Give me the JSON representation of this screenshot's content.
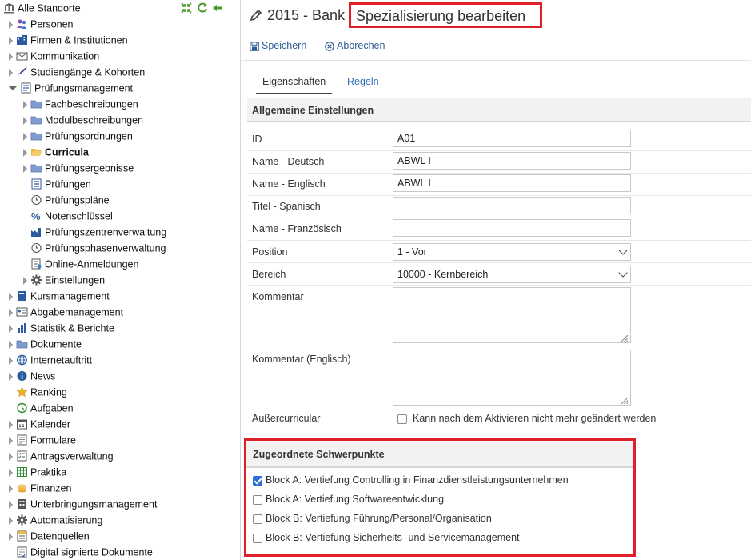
{
  "sidebar": {
    "root_label": "Alle Standorte",
    "items": [
      {
        "label": "Personen",
        "level": 1,
        "exp": "closed",
        "icon": "persons-icon",
        "bold": false
      },
      {
        "label": "Firmen & Institutionen",
        "level": 1,
        "exp": "closed",
        "icon": "companies-icon",
        "bold": false
      },
      {
        "label": "Kommunikation",
        "level": 1,
        "exp": "closed",
        "icon": "mail-icon",
        "bold": false
      },
      {
        "label": "Studiengänge & Kohorten",
        "level": 1,
        "exp": "closed",
        "icon": "quill-icon",
        "bold": false
      },
      {
        "label": "Prüfungsmanagement",
        "level": 1,
        "exp": "open",
        "icon": "exam-list-icon",
        "bold": false
      },
      {
        "label": "Fachbeschreibungen",
        "level": 2,
        "exp": "closed",
        "icon": "folder-icon",
        "bold": false
      },
      {
        "label": "Modulbeschreibungen",
        "level": 2,
        "exp": "closed",
        "icon": "folder-icon",
        "bold": false
      },
      {
        "label": "Prüfungsordnungen",
        "level": 2,
        "exp": "closed",
        "icon": "folder-icon",
        "bold": false
      },
      {
        "label": "Curricula",
        "level": 2,
        "exp": "closed",
        "icon": "folder-open-icon",
        "bold": true
      },
      {
        "label": "Prüfungsergebnisse",
        "level": 2,
        "exp": "closed",
        "icon": "folder-icon",
        "bold": false
      },
      {
        "label": "Prüfungen",
        "level": 2,
        "exp": "none",
        "icon": "exam-icon",
        "bold": false
      },
      {
        "label": "Prüfungspläne",
        "level": 2,
        "exp": "none",
        "icon": "clock-icon",
        "bold": false
      },
      {
        "label": "Notenschlüssel",
        "level": 2,
        "exp": "none",
        "icon": "percent-icon",
        "bold": false
      },
      {
        "label": "Prüfungszentrenverwaltung",
        "level": 2,
        "exp": "none",
        "icon": "factory-icon",
        "bold": false
      },
      {
        "label": "Prüfungsphasenverwaltung",
        "level": 2,
        "exp": "none",
        "icon": "clock-icon",
        "bold": false
      },
      {
        "label": "Online-Anmeldungen",
        "level": 2,
        "exp": "none",
        "icon": "online-form-icon",
        "bold": false
      },
      {
        "label": "Einstellungen",
        "level": 2,
        "exp": "closed",
        "icon": "gear-icon",
        "bold": false
      },
      {
        "label": "Kursmanagement",
        "level": 1,
        "exp": "closed",
        "icon": "book-icon",
        "bold": false
      },
      {
        "label": "Abgabemanagement",
        "level": 1,
        "exp": "closed",
        "icon": "id-card-icon",
        "bold": false
      },
      {
        "label": "Statistik & Berichte",
        "level": 1,
        "exp": "closed",
        "icon": "bar-chart-icon",
        "bold": false
      },
      {
        "label": "Dokumente",
        "level": 1,
        "exp": "closed",
        "icon": "folder-icon",
        "bold": false
      },
      {
        "label": "Internetauftritt",
        "level": 1,
        "exp": "closed",
        "icon": "globe-icon",
        "bold": false
      },
      {
        "label": "News",
        "level": 1,
        "exp": "closed",
        "icon": "info-icon",
        "bold": false
      },
      {
        "label": "Ranking",
        "level": 1,
        "exp": "none",
        "icon": "star-icon",
        "bold": false
      },
      {
        "label": "Aufgaben",
        "level": 1,
        "exp": "none",
        "icon": "history-icon",
        "bold": false
      },
      {
        "label": "Kalender",
        "level": 1,
        "exp": "closed",
        "icon": "calendar-icon",
        "bold": false
      },
      {
        "label": "Formulare",
        "level": 1,
        "exp": "closed",
        "icon": "form-icon",
        "bold": false
      },
      {
        "label": "Antragsverwaltung",
        "level": 1,
        "exp": "closed",
        "icon": "checklist-icon",
        "bold": false
      },
      {
        "label": "Praktika",
        "level": 1,
        "exp": "closed",
        "icon": "grid-icon",
        "bold": false
      },
      {
        "label": "Finanzen",
        "level": 1,
        "exp": "closed",
        "icon": "coins-icon",
        "bold": false
      },
      {
        "label": "Unterbringungsmanagement",
        "level": 1,
        "exp": "closed",
        "icon": "building-icon",
        "bold": false
      },
      {
        "label": "Automatisierung",
        "level": 1,
        "exp": "closed",
        "icon": "gear-icon",
        "bold": false
      },
      {
        "label": "Datenquellen",
        "level": 1,
        "exp": "closed",
        "icon": "database-icon",
        "bold": false
      },
      {
        "label": "Digital signierte Dokumente",
        "level": 1,
        "exp": "none",
        "icon": "signed-doc-icon",
        "bold": false
      }
    ]
  },
  "header": {
    "title_prefix": "2015 - Bank",
    "title_main": "Spezialisierung bearbeiten"
  },
  "toolbar": {
    "save_label": "Speichern",
    "cancel_label": "Abbrechen"
  },
  "tabs": {
    "properties": "Eigenschaften",
    "rules": "Regeln"
  },
  "general": {
    "heading": "Allgemeine Einstellungen",
    "id_label": "ID",
    "id_value": "A01",
    "name_de_label": "Name - Deutsch",
    "name_de_value": "ABWL I",
    "name_en_label": "Name - Englisch",
    "name_en_value": "ABWL I",
    "title_es_label": "Titel - Spanisch",
    "title_es_value": "",
    "name_fr_label": "Name - Französisch",
    "name_fr_value": "",
    "position_label": "Position",
    "position_value": "1 - Vor",
    "area_label": "Bereich",
    "area_value": "10000 - Kernbereich",
    "comment_label": "Kommentar",
    "comment_en_label": "Kommentar (Englisch)",
    "extracurricular_label": "Außercurricular",
    "extracurricular_text": "Kann nach dem Aktivieren nicht mehr geändert werden"
  },
  "focus": {
    "heading": "Zugeordnete Schwerpunkte",
    "items": [
      {
        "label": "Block A: Vertiefung Controlling in Finanzdienstleistungsunternehmen",
        "checked": true
      },
      {
        "label": "Block A: Vertiefung Softwareentwicklung",
        "checked": false
      },
      {
        "label": "Block B: Vertiefung Führung/Personal/Organisation",
        "checked": false
      },
      {
        "label": "Block B: Vertiefung Sicherheits- und Servicemanagement",
        "checked": false
      }
    ]
  },
  "colors": {
    "highlight": "#e02028",
    "link": "#2e6fb5",
    "checkbox_on": "#2b6fd8"
  }
}
